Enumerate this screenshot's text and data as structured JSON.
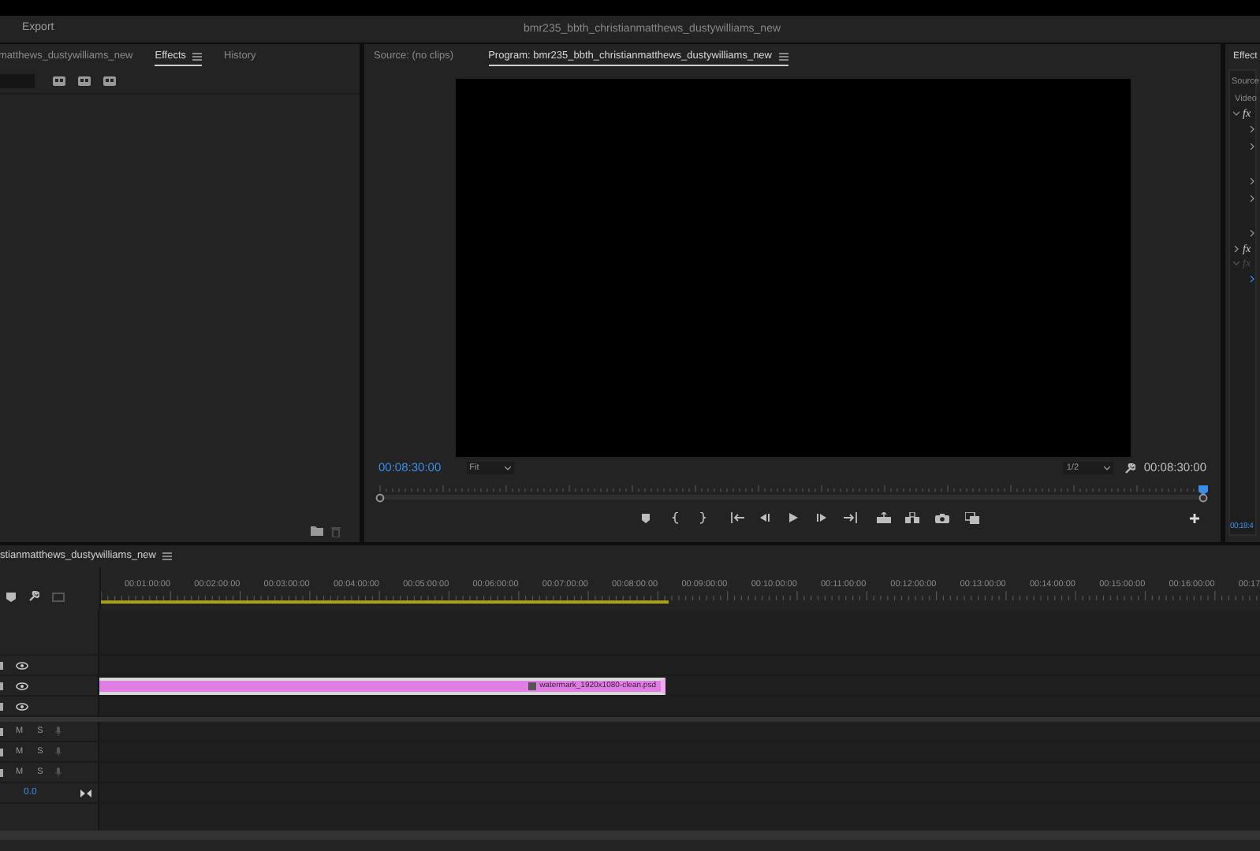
{
  "menu_bar": {
    "items": [
      "Export"
    ],
    "title": "bmr235_bbth_christianmatthews_dustywilliams_new"
  },
  "effects_panel": {
    "tabs": [
      {
        "label": "matthews_dustywilliams_new",
        "selected": false,
        "menu": false
      },
      {
        "label": "Effects",
        "selected": true,
        "menu": true
      },
      {
        "label": "History",
        "selected": false,
        "menu": false
      }
    ]
  },
  "program_monitor": {
    "tabs": [
      {
        "label": "Source: (no clips)",
        "selected": false,
        "menu": false
      },
      {
        "label": "Program: bmr235_bbth_christianmatthews_dustywilliams_new",
        "selected": true,
        "menu": true
      }
    ],
    "timecode": "00:08:30:00",
    "zoom": "Fit",
    "resolution": "1/2",
    "duration": "00:08:30:00",
    "playhead": {
      "level": 1
    }
  },
  "effect_controls": {
    "title": "Effect",
    "source": "Source",
    "section": "Video",
    "effects": [
      {
        "label": "fx",
        "expanded": true,
        "enabled": true
      },
      {
        "label": "fx",
        "expanded": false,
        "enabled": true
      },
      {
        "label": "fx",
        "expanded": true,
        "enabled": false
      }
    ],
    "timecode": "00:18:4"
  },
  "timeline": {
    "tab": {
      "label": "stianmatthews_dustywilliams_new",
      "selected": true
    },
    "ruler_labels": [
      "00:01:00:00",
      "00:02:00:00",
      "00:03:00:00",
      "00:04:00:00",
      "00:05:00:00",
      "00:06:00:00",
      "00:07:00:00",
      "00:08:00:00",
      "00:09:00:00",
      "00:10:00:00",
      "00:11:00:00",
      "00:12:00:00",
      "00:13:00:00",
      "00:14:00:00",
      "00:15:00:00",
      "00:16:00:00",
      "00:17"
    ],
    "video_tracks": [
      {
        "visible": true
      },
      {
        "visible": true,
        "clip": {
          "name": "watermark_1920x1080-clean.psd"
        }
      },
      {
        "visible": true
      }
    ],
    "audio_tracks": [
      {
        "mute": "M",
        "solo": "S"
      },
      {
        "mute": "M",
        "solo": "S"
      },
      {
        "mute": "M",
        "solo": "S"
      }
    ],
    "master_volume": "0.0"
  }
}
